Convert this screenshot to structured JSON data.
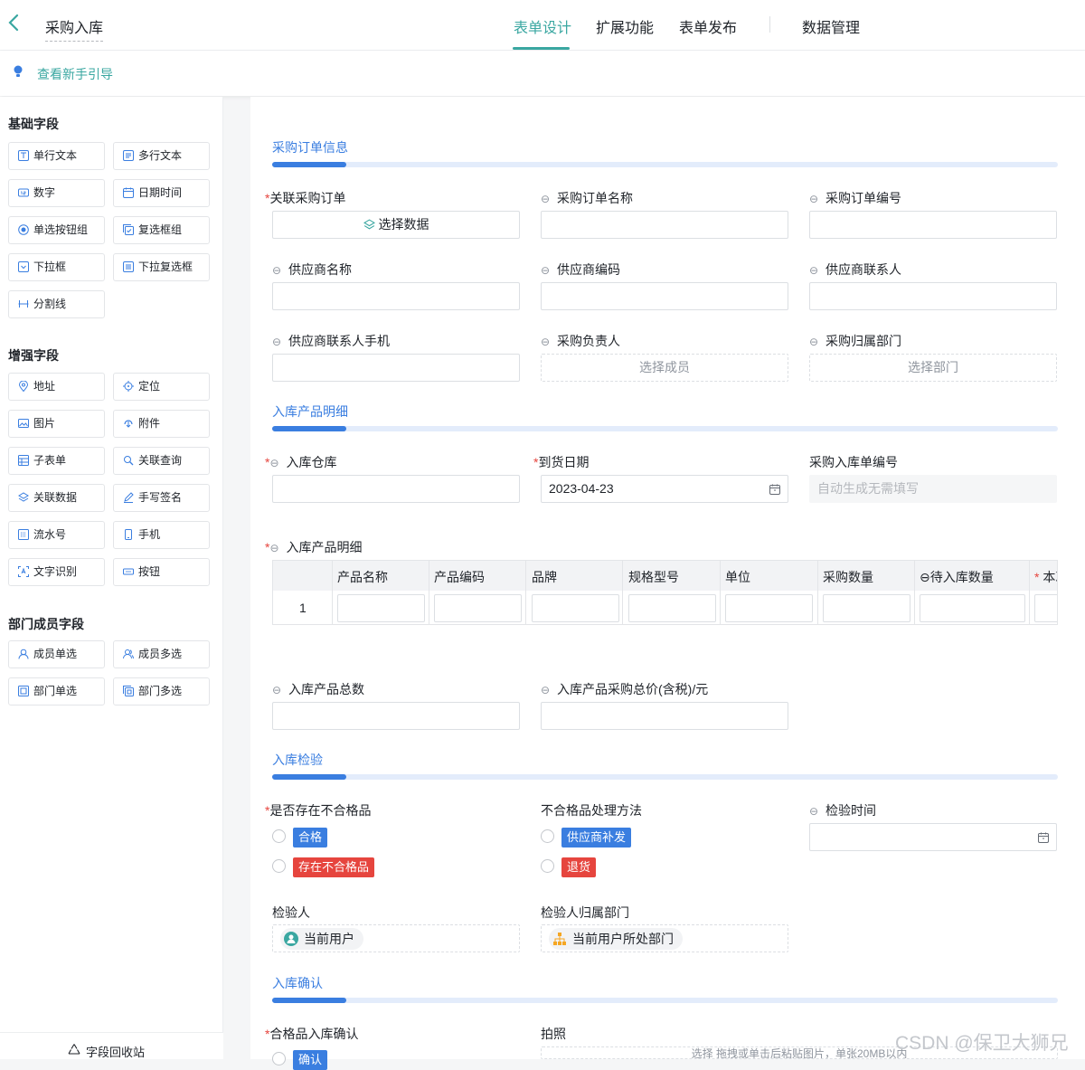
{
  "header": {
    "title": "采购入库",
    "tabs": [
      "表单设计",
      "扩展功能",
      "表单发布",
      "数据管理"
    ]
  },
  "guide": {
    "label": "查看新手引导"
  },
  "sidebar": {
    "groups": [
      {
        "title": "基础字段",
        "items": [
          "单行文本",
          "多行文本",
          "数字",
          "日期时间",
          "单选按钮组",
          "复选框组",
          "下拉框",
          "下拉复选框",
          "分割线"
        ]
      },
      {
        "title": "增强字段",
        "items": [
          "地址",
          "定位",
          "图片",
          "附件",
          "子表单",
          "关联查询",
          "关联数据",
          "手写签名",
          "流水号",
          "手机",
          "文字识别",
          "按钮"
        ]
      },
      {
        "title": "部门成员字段",
        "items": [
          "成员单选",
          "成员多选",
          "部门单选",
          "部门多选"
        ]
      }
    ],
    "recycle": "字段回收站"
  },
  "form": {
    "sections": [
      "采购订单信息",
      "入库产品明细",
      "入库检验",
      "入库确认"
    ],
    "order": {
      "f1": "关联采购订单",
      "f1_btn": "选择数据",
      "f2": "采购订单名称",
      "f3": "采购订单编号",
      "f4": "供应商名称",
      "f5": "供应商编码",
      "f6": "供应商联系人",
      "f7": "供应商联系人手机",
      "f8": "采购负责人",
      "f8_ph": "选择成员",
      "f9": "采购归属部门",
      "f9_ph": "选择部门"
    },
    "detail": {
      "warehouse": "入库仓库",
      "date": "到货日期",
      "date_val": "2023-04-23",
      "no": "采购入库单编号",
      "no_ph": "自动生成无需填写",
      "table_label": "入库产品明细",
      "cols": [
        "产品名称",
        "产品编码",
        "品牌",
        "规格型号",
        "单位",
        "采购数量",
        "待入库数量",
        "本次"
      ],
      "row1": "1",
      "total_count": "入库产品总数",
      "total_price": "入库产品采购总价(含税)/元"
    },
    "check": {
      "q1": "是否存在不合格品",
      "q1_opts": [
        "合格",
        "存在不合格品"
      ],
      "q2": "不合格品处理方法",
      "q2_opts": [
        "供应商补发",
        "退货"
      ],
      "q3": "检验时间",
      "q4": "检验人",
      "q4_val": "当前用户",
      "q5": "检验人归属部门",
      "q5_val": "当前用户所处部门"
    },
    "confirm": {
      "c1": "合格品入库确认",
      "c2": "拍照",
      "c2_hint": "选择  拖拽或单击后粘贴图片，单张20MB以内",
      "c1_tag": "确认"
    }
  },
  "watermark": "CSDN @保卫大狮兄",
  "colors": {
    "accent": "#3aa7a1",
    "section": "#3a7ee0",
    "danger": "#e6453e"
  }
}
